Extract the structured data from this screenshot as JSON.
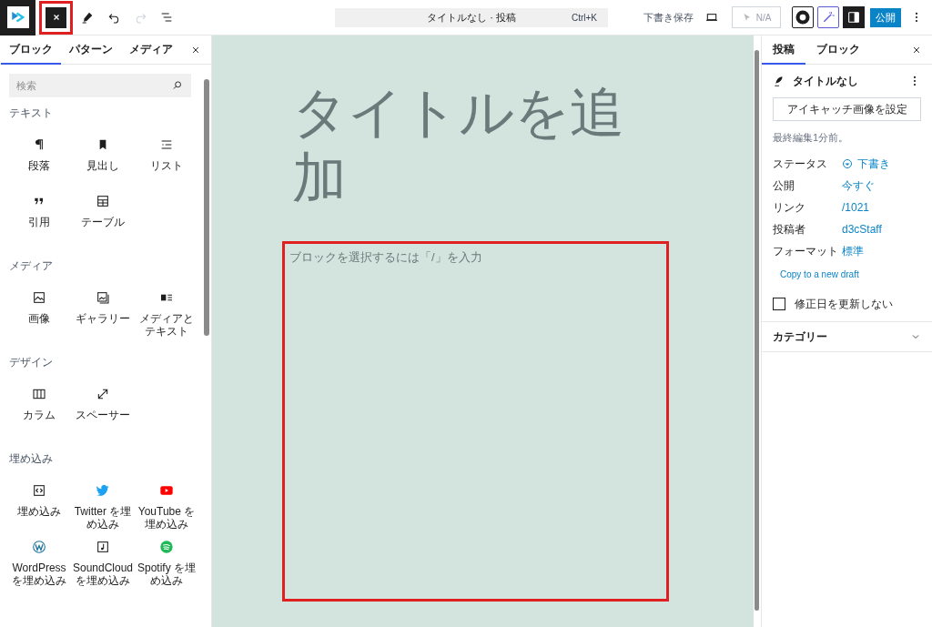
{
  "toolbar": {
    "close_highlighted": true,
    "undo_disabled": false,
    "redo_disabled": true,
    "command": {
      "title": "タイトルなし · 投稿",
      "shortcut": "Ctrl+K"
    },
    "save_draft": "下書き保存",
    "na_label": "N/A",
    "settings_pressed": true,
    "publish": "公開"
  },
  "inserter": {
    "tabs": [
      {
        "label": "ブロック",
        "selected": true
      },
      {
        "label": "パターン",
        "selected": false
      },
      {
        "label": "メディア",
        "selected": false
      }
    ],
    "search": {
      "placeholder": "検索"
    },
    "sections": [
      {
        "title": "テキスト",
        "items": [
          "段落",
          "見出し",
          "リスト",
          "引用",
          "テーブル"
        ]
      },
      {
        "title": "メディア",
        "items": [
          "画像",
          "ギャラリー",
          "メディアとテキスト"
        ]
      },
      {
        "title": "デザイン",
        "items": [
          "カラム",
          "スペーサー"
        ]
      },
      {
        "title": "埋め込み",
        "items": [
          "埋め込み",
          "Twitter を埋め込み",
          "YouTube を埋め込み",
          "WordPress を埋め込み",
          "SoundCloud を埋め込み",
          "Spotify を埋め込み"
        ]
      }
    ]
  },
  "canvas": {
    "title_placeholder": "タイトルを追加",
    "block_placeholder": "ブロックを選択するには「/」を入力",
    "block_highlighted": true
  },
  "settings": {
    "tabs": [
      {
        "label": "投稿",
        "selected": true
      },
      {
        "label": "ブロック",
        "selected": false
      }
    ],
    "post_title": "タイトルなし",
    "featured_image_button": "アイキャッチ画像を設定",
    "last_edited": "最終編集1分前。",
    "rows": [
      {
        "label": "ステータス",
        "value": "下書き"
      },
      {
        "label": "公開",
        "value": "今すぐ"
      },
      {
        "label": "リンク",
        "value": "/1021"
      },
      {
        "label": "投稿者",
        "value": "d3cStaff"
      },
      {
        "label": "フォーマット",
        "value": "標準"
      }
    ],
    "copy_link": "Copy to a new draft",
    "keep_date": {
      "label": "修正日を更新しない",
      "checked": false
    },
    "panels": [
      {
        "title": "カテゴリー",
        "expanded": false
      }
    ]
  }
}
